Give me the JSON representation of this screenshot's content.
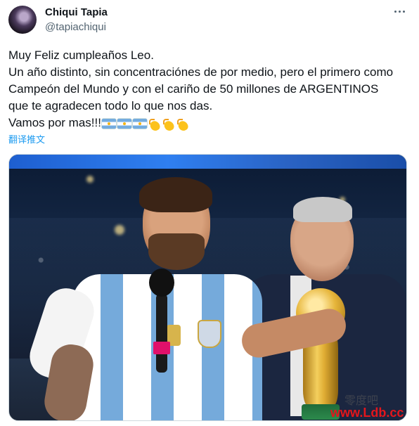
{
  "author": {
    "name": "Chiqui Tapia",
    "handle": "@tapiachiqui"
  },
  "tweet": {
    "lines": [
      "Muy Feliz cumpleaños Leo.",
      "Un año distinto, sin concentraciónes de por medio, pero el primero como",
      "Campeón del Mundo y con el cariño de 50 millones de ARGENTINOS",
      "que te agradecen todo lo que nos das.",
      "Vamos por mas!!!"
    ],
    "emojis": [
      "argentina-flag",
      "argentina-flag",
      "argentina-flag",
      "clapping-hands",
      "clapping-hands",
      "clapping-hands"
    ],
    "translate_label": "翻译推文"
  },
  "media": {
    "kind": "photo"
  },
  "watermark": {
    "text": "www.Ldb.cc",
    "chinese_text": "零度吧"
  },
  "colors": {
    "link": "#1d9bf0",
    "secondary_text": "#536471",
    "primary_text": "#0f1419",
    "watermark": "#e4161c"
  }
}
